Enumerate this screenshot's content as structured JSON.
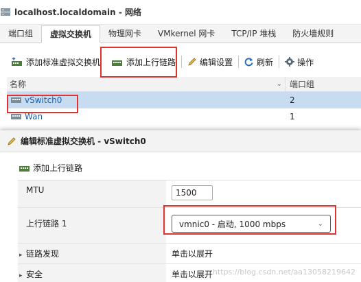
{
  "window": {
    "title": "localhost.localdomain - 网络"
  },
  "tabs": [
    {
      "label": "端口组"
    },
    {
      "label": "虚拟交换机"
    },
    {
      "label": "物理网卡"
    },
    {
      "label": "VMkernel 网卡"
    },
    {
      "label": "TCP/IP 堆栈"
    },
    {
      "label": "防火墙规则"
    }
  ],
  "toolbar": {
    "add_std_switch": "添加标准虚拟交换机",
    "add_uplink": "添加上行链路",
    "edit_settings": "编辑设置",
    "refresh": "刷新",
    "actions": "操作"
  },
  "grid": {
    "columns": [
      "名称",
      "端口组"
    ],
    "rows": [
      {
        "name": "vSwitch0",
        "portgroups": "2"
      },
      {
        "name": "Wan",
        "portgroups": "1"
      }
    ]
  },
  "dialog": {
    "title": "编辑标准虚拟交换机 - vSwitch0",
    "add_uplink": "添加上行链路",
    "mtu_label": "MTU",
    "mtu_value": "1500",
    "uplink_label": "上行链路 1",
    "uplink_value": "vmnic0 - 启动, 1000 mbps",
    "link_discovery_label": "链路发现",
    "link_discovery_value": "单击以展开",
    "security_label": "安全",
    "security_value": "单击以展开"
  },
  "watermark": "https://blog.csdn.net/aa13058219642",
  "colors": {
    "highlight": "#e0322f",
    "selected_row": "#c7dcf0",
    "link": "#1a5fa8"
  }
}
